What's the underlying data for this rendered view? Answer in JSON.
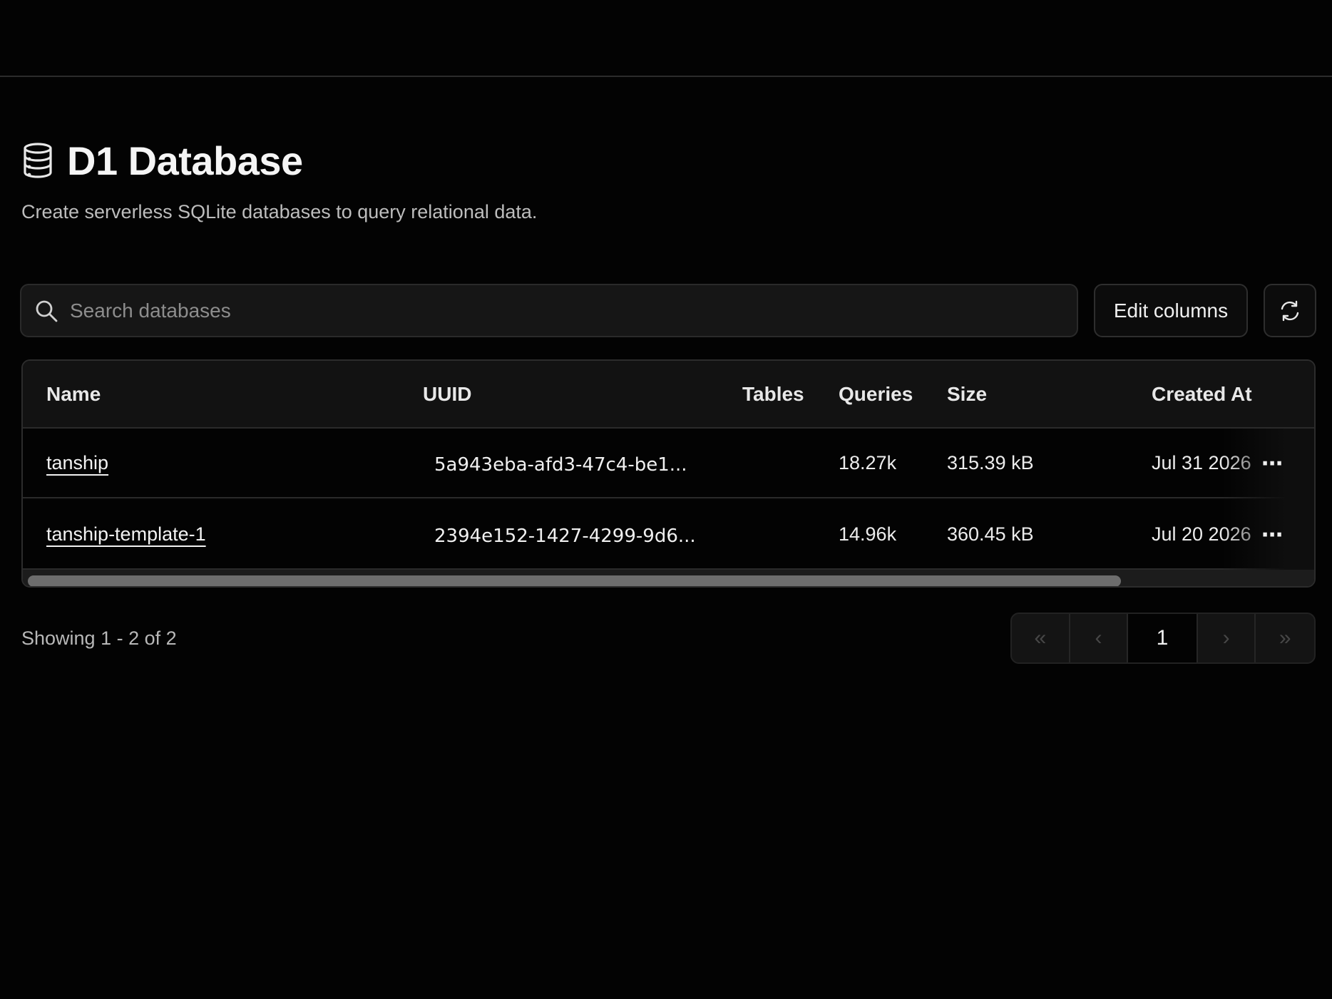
{
  "header": {
    "title": "D1 Database",
    "subtitle": "Create serverless SQLite databases to query relational data."
  },
  "search": {
    "placeholder": "Search databases",
    "value": ""
  },
  "toolbar": {
    "edit_columns_label": "Edit columns"
  },
  "table": {
    "columns": [
      "Name",
      "UUID",
      "Tables",
      "Queries",
      "Size",
      "Created At"
    ],
    "rows": [
      {
        "name": "tanship",
        "uuid": "5a943eba-afd3-47c4-be1...",
        "tables": "",
        "queries": "18.27k",
        "size": "315.39 kB",
        "created_at": "Jul 31 2026"
      },
      {
        "name": "tanship-template-1",
        "uuid": "2394e152-1427-4299-9d6...",
        "tables": "",
        "queries": "14.96k",
        "size": "360.45 kB",
        "created_at": "Jul 20 2026"
      }
    ],
    "row_actions_label": "⋯"
  },
  "footer": {
    "showing": "Showing 1 - 2 of 2"
  },
  "pagination": {
    "first": "«",
    "prev": "‹",
    "current": "1",
    "next": "›",
    "last": "»"
  },
  "icons": {
    "db": "database-icon",
    "search": "search-icon",
    "refresh": "refresh-icon"
  }
}
